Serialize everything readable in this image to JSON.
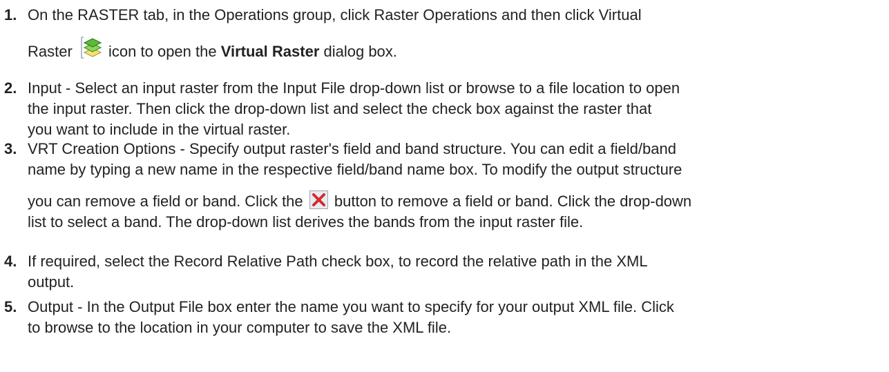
{
  "steps": [
    {
      "number": "1.",
      "line1": "On the RASTER tab, in the Operations group, click Raster Operations and then click Virtual",
      "line2_before": "Raster ",
      "icon": "virtual-raster-icon",
      "line2_mid": " icon to open the ",
      "line2_bold": "Virtual Raster",
      "line2_after": "  dialog box."
    },
    {
      "number": "2.",
      "lines": [
        "Input - Select an input raster from the Input File drop-down list or browse to a file location to open",
        "the input raster. Then click the drop-down list and select the check box against the raster that",
        "you want to include in the virtual raster."
      ]
    },
    {
      "number": "3.",
      "line1": "VRT Creation Options - Specify output raster's field and band structure. You can edit a field/band",
      "line2": "name by typing a new name in the respective field/band name box. To modify the output structure",
      "line3_before": "you can remove a field or band. Click the ",
      "icon": "remove-x-icon",
      "line3_after": " button to remove a field or band. Click the drop-down",
      "line4": "list to select a band. The drop-down list derives the bands from the input raster file."
    },
    {
      "number": "4.",
      "lines": [
        "If required, select the Record Relative Path check box, to record the relative path in the XML",
        "output."
      ]
    },
    {
      "number": "5.",
      "lines": [
        "Output - In the Output File box enter the name you want to specify for your output XML file. Click",
        "to browse to the location in your computer to save the XML file."
      ]
    }
  ],
  "colors": {
    "text": "#222222",
    "icon_green_dark": "#3f8f2a",
    "icon_green_light": "#8fd45a",
    "icon_yellow": "#f2e27a",
    "x_red": "#d42b2b",
    "x_bg": "#e6ebf2"
  }
}
